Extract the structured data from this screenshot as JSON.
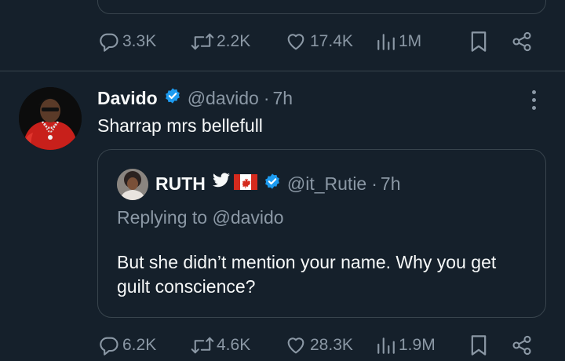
{
  "prev_tweet": {
    "replies": "3.3K",
    "retweets": "2.2K",
    "likes": "17.4K",
    "views": "1M"
  },
  "tweet": {
    "author_name": "Davido",
    "handle": "@davido",
    "dot": "·",
    "time": "7h",
    "text": "Sharrap mrs bellefull",
    "replies": "6.2K",
    "retweets": "4.6K",
    "likes": "28.3K",
    "views": "1.9M"
  },
  "quote": {
    "author_name": "RUTH",
    "emojis": [
      "twitter-bird",
      "canada-flag"
    ],
    "handle": "@it_Rutie",
    "dot": "·",
    "time": "7h",
    "replying_prefix": "Replying to ",
    "replying_handle": "@davido",
    "text": "But she didn’t mention your name. Why you get guilt conscience?"
  },
  "colors": {
    "background": "#15202b",
    "border": "#38444d",
    "muted": "#8b98a5",
    "text": "#f7f9f9",
    "verified": "#1d9bf0",
    "link": "#8b98a5"
  },
  "icons": [
    "reply-icon",
    "retweet-icon",
    "like-icon",
    "views-icon",
    "bookmark-icon",
    "share-icon",
    "verified-icon",
    "more-icon"
  ]
}
